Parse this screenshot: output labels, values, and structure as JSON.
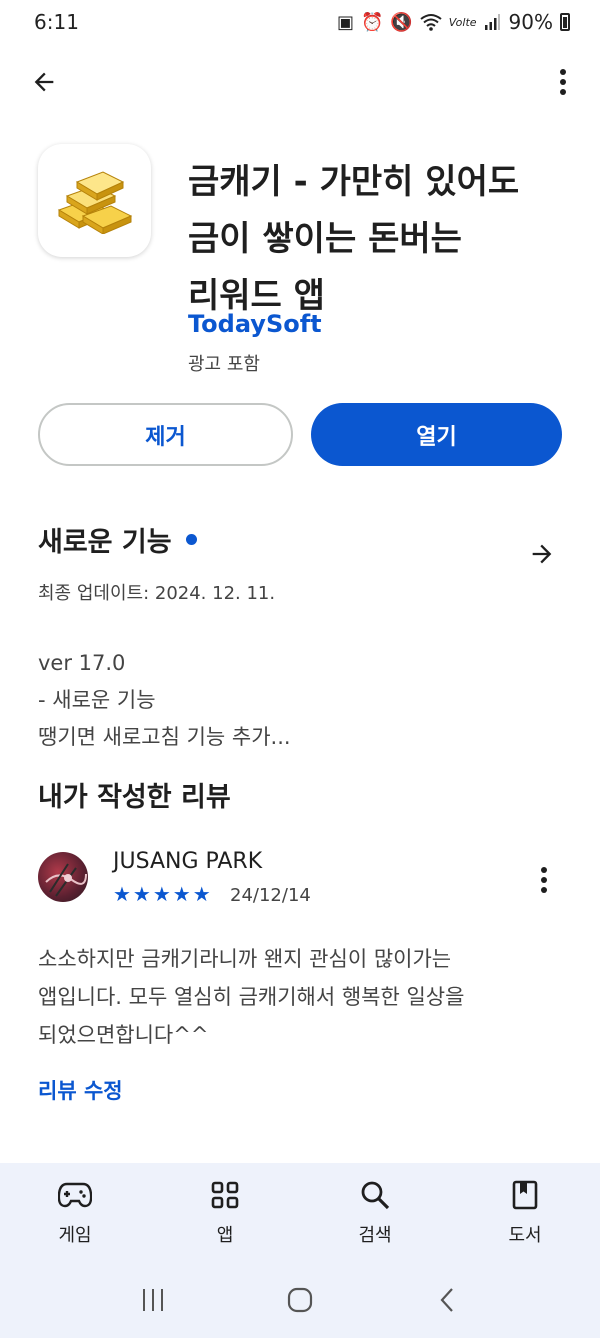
{
  "status_bar": {
    "time": "6:11",
    "battery": "90%",
    "icons": [
      "image-icon",
      "alarm-icon",
      "mute-icon",
      "wifi-icon",
      "volte-icon",
      "signal-icon",
      "battery-icon"
    ]
  },
  "top_bar": {
    "back_icon": "arrow-back-icon",
    "more_icon": "more-vert-icon"
  },
  "app": {
    "icon": "gold-bars-icon",
    "title_lines": [
      "금캐기 - 가만히 있어도",
      "금이 쌓이는 돈버는",
      "리워드 앱"
    ],
    "developer": "TodaySoft",
    "ads_label": "광고 포함"
  },
  "buttons": {
    "uninstall": "제거",
    "open": "열기"
  },
  "whats_new": {
    "heading": "새로운 기능",
    "date": "최종 업데이트: 2024. 12. 11.",
    "notes": [
      "ver 17.0",
      "- 새로운 기능",
      "땡기면 새로고침 기능 추가..."
    ]
  },
  "my_review": {
    "heading": "내가 작성한 리뷰",
    "reviewer_name": "JUSANG PARK",
    "rating": 5,
    "stars": "★★★★★",
    "date": "24/12/14",
    "text_lines": [
      "소소하지만 금캐기라니까 왠지 관심이 많이가는",
      "앱입니다. 모두 열심히 금캐기해서 행복한 일상을",
      "되었으면합니다^^"
    ],
    "edit_label": "리뷰 수정"
  },
  "bottom_nav": {
    "items": [
      {
        "label": "게임",
        "icon": "gamepad-icon"
      },
      {
        "label": "앱",
        "icon": "apps-grid-icon"
      },
      {
        "label": "검색",
        "icon": "search-icon"
      },
      {
        "label": "도서",
        "icon": "book-icon"
      }
    ]
  },
  "system_nav": [
    "recents-icon",
    "home-icon",
    "back-icon"
  ],
  "colors": {
    "accent": "#0b57d0",
    "nav_background": "#eef2fb",
    "text_primary": "#1f1f1f",
    "text_secondary": "#444444"
  }
}
